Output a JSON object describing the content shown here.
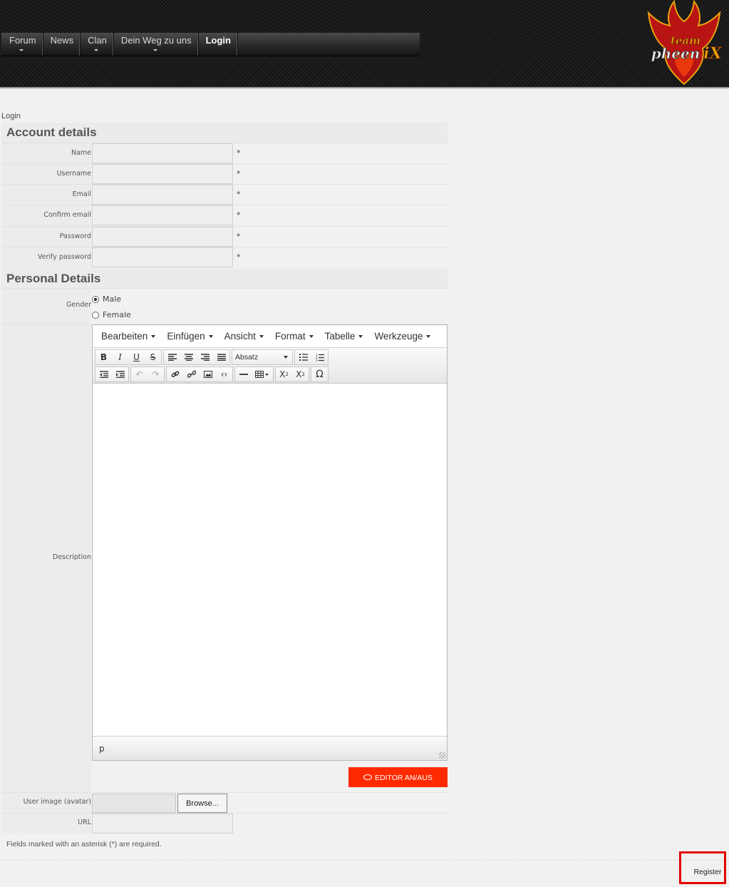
{
  "header": {
    "nav": [
      {
        "label": "Forum",
        "has_submenu": true
      },
      {
        "label": "News",
        "has_submenu": false
      },
      {
        "label": "Clan",
        "has_submenu": true
      },
      {
        "label": "Dein Weg zu uns",
        "has_submenu": true
      },
      {
        "label": "Login",
        "has_submenu": false,
        "active": true
      }
    ],
    "logo": {
      "top_text": "team",
      "main_text": "pheen",
      "accent_text": "iX",
      "color": "#e8a20c"
    }
  },
  "breadcrumb": "Login",
  "account": {
    "title": "Account details",
    "fields": [
      {
        "label": "Name",
        "value": "",
        "required": "*"
      },
      {
        "label": "Username",
        "value": "",
        "required": "*"
      },
      {
        "label": "Email",
        "value": "",
        "required": "*"
      },
      {
        "label": "Confirm email",
        "value": "",
        "required": "*"
      },
      {
        "label": "Password",
        "value": "",
        "required": "*"
      },
      {
        "label": "Verify password",
        "value": "",
        "required": "*"
      }
    ]
  },
  "personal": {
    "title": "Personal Details",
    "gender_label": "Gender",
    "gender_options": [
      {
        "label": "Male",
        "checked": true
      },
      {
        "label": "Female",
        "checked": false
      }
    ],
    "description_label": "Description",
    "editor": {
      "menus": [
        "Bearbeiten",
        "Einfügen",
        "Ansicht",
        "Format",
        "Tabelle",
        "Werkzeuge"
      ],
      "format_select": "Absatz",
      "status_path": "p",
      "toggle_label": "EDITOR AN/AUS"
    },
    "avatar_label": "User image (avatar)",
    "browse_label": "Browse...",
    "url_label": "URL",
    "url_value": ""
  },
  "note": "Fields marked with an asterisk (*) are required.",
  "register_label": "Register",
  "colors": {
    "accent": "#ff2a00",
    "highlight": "#e60000"
  }
}
